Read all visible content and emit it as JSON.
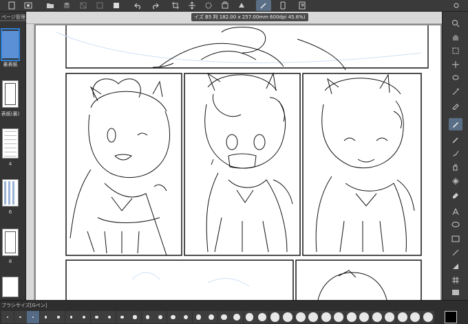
{
  "toolbar": {
    "items": [
      "new-icon",
      "file-icon",
      "open-icon",
      "save-icon",
      "transform-icon",
      "clear-icon",
      "fill-icon",
      "undo-icon",
      "redo-icon",
      "crop-icon",
      "move-icon",
      "rotate-icon",
      "select-icon",
      "snap-icon",
      "active-pen-icon",
      "device-icon",
      "help-icon"
    ],
    "active": "active-pen-icon"
  },
  "page_panel": {
    "title": "ページ管理",
    "pages": [
      {
        "label": "裏表紙",
        "selected": true
      },
      {
        "label": "表紙(裏)",
        "selected": false
      },
      {
        "label": "4",
        "selected": false
      },
      {
        "label": "6",
        "selected": false
      },
      {
        "label": "8",
        "selected": false
      },
      {
        "label": "",
        "selected": false
      }
    ]
  },
  "canvas": {
    "doc_tab": "イズ B5 判 182.00 x 257.00mm 600dpi 45.6%)"
  },
  "tools": {
    "items": [
      "zoom-icon",
      "hand-icon",
      "selection-icon",
      "move-tool-icon",
      "lasso-icon",
      "magic-wand-icon",
      "eyedropper-icon",
      "pen-icon",
      "pencil-icon",
      "brush-icon",
      "airbrush-icon",
      "decoration-icon",
      "eraser-icon",
      "text-icon",
      "balloon-icon",
      "frame-icon",
      "line-icon",
      "ruler-icon",
      "grid-icon",
      "gradient-icon"
    ],
    "active": "pen-icon"
  },
  "brush_size": {
    "title": "ブラシサイズ[Gペン]",
    "sizes": [
      0.7,
      1,
      1.5,
      2,
      2.5,
      3,
      4,
      5,
      6,
      7,
      8,
      10,
      12,
      15,
      17,
      20,
      25,
      30,
      40,
      50,
      60,
      70,
      80,
      100,
      120,
      150,
      170,
      200,
      250,
      300,
      400,
      500,
      600,
      700,
      800,
      1000
    ],
    "selected": 1.5
  },
  "colors": {
    "accent": "#2d7fd4",
    "active_tool": "#5a6f86",
    "main_color": "#000000"
  }
}
